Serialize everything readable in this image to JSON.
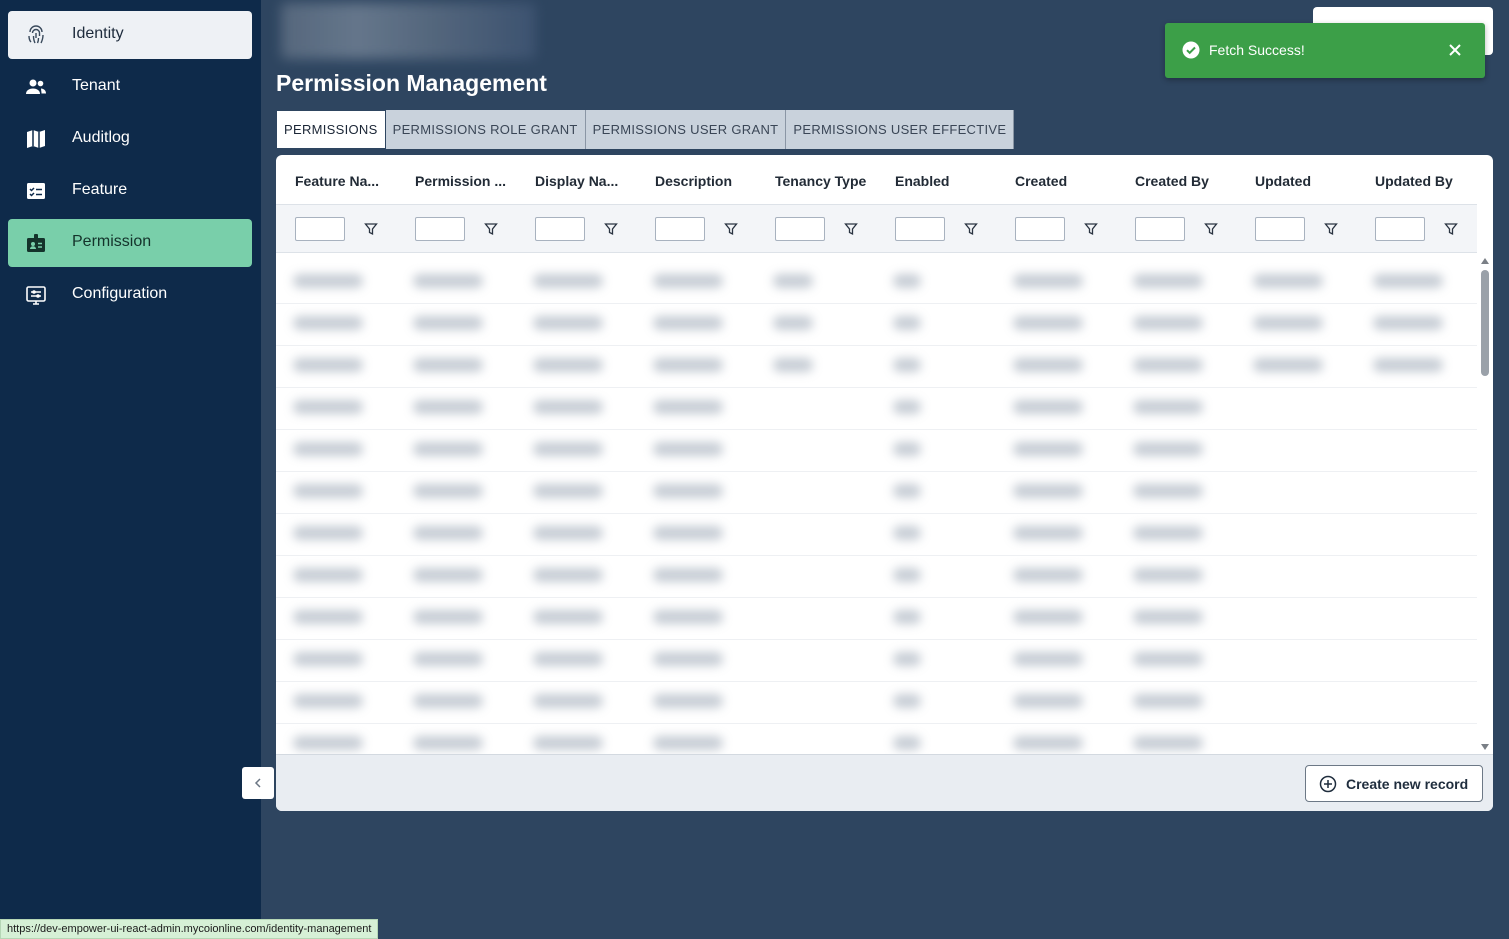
{
  "sidebar": {
    "items": [
      {
        "label": "Identity",
        "icon": "fingerprint-icon"
      },
      {
        "label": "Tenant",
        "icon": "users-icon"
      },
      {
        "label": "Auditlog",
        "icon": "map-icon"
      },
      {
        "label": "Feature",
        "icon": "checklist-icon"
      },
      {
        "label": "Permission",
        "icon": "badge-icon"
      },
      {
        "label": "Configuration",
        "icon": "settings-panel-icon"
      }
    ],
    "active_item": "Permission",
    "collapse_icon": "chevron-left-icon"
  },
  "header": {
    "title": "Permission Management"
  },
  "tabs": [
    {
      "label": "PERMISSIONS",
      "active": true
    },
    {
      "label": "PERMISSIONS ROLE GRANT",
      "active": false
    },
    {
      "label": "PERMISSIONS USER GRANT",
      "active": false
    },
    {
      "label": "PERMISSIONS USER EFFECTIVE",
      "active": false
    }
  ],
  "grid": {
    "columns": [
      "Feature Na...",
      "Permission ...",
      "Display Na...",
      "Description",
      "Tenancy Type",
      "Enabled",
      "Created",
      "Created By",
      "Updated",
      "Updated By"
    ],
    "filter_icon": "filter-icon",
    "footer": {
      "create_label": "Create new record",
      "create_icon": "plus-circle-icon"
    }
  },
  "toast": {
    "message": "Fetch Success!",
    "icon": "check-circle-icon",
    "close_icon": "close-icon",
    "color": "#3c9f48"
  },
  "status_bar": {
    "url": "https://dev-empower-ui-react-admin.mycoionline.com/identity-management"
  },
  "colors": {
    "sidebar_bg": "#0e2a4a",
    "page_bg": "#2e4560",
    "active_nav": "#79cfaa"
  }
}
